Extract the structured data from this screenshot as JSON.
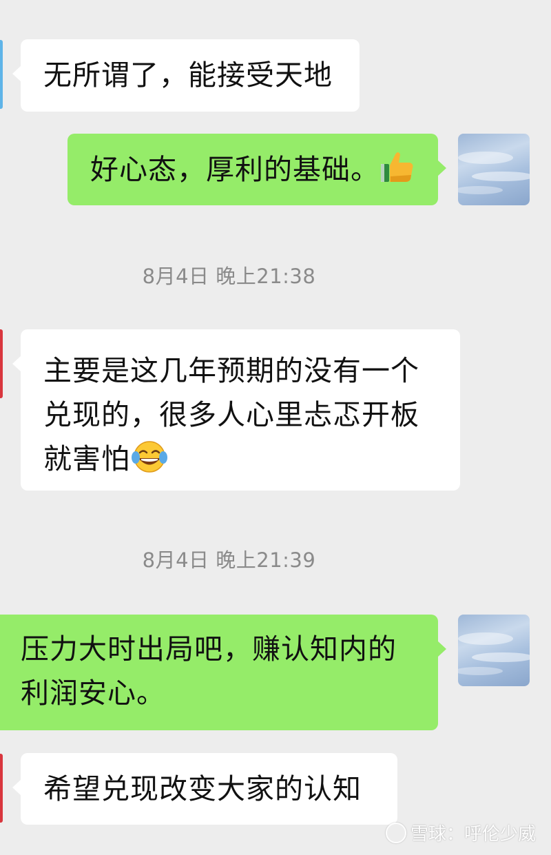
{
  "messages": [
    {
      "id": "m1",
      "text": "无所谓了，能接受天地"
    },
    {
      "id": "m2",
      "text": "好心态，厚利的基础。",
      "emoji": "thumbs-up-icon"
    },
    {
      "id": "m3",
      "text_line1": "主要是这几年预期的没有一个",
      "text_line2": "兑现的，很多人心里忐忑开板",
      "text_line3": "就害怕",
      "emoji": "tears-of-joy-icon"
    },
    {
      "id": "m4",
      "text_line1": "压力大时出局吧，赚认知内的",
      "text_line2": "利润安心。"
    },
    {
      "id": "m5",
      "text": "希望兑现改变大家的认知"
    }
  ],
  "timestamps": [
    "8月4日 晚上21:38",
    "8月4日 晚上21:39"
  ],
  "watermark": {
    "text": "雪球：呼伦少威"
  },
  "colors": {
    "background": "#ededed",
    "incoming_bubble": "#ffffff",
    "outgoing_bubble": "#95ec69",
    "timestamp_text": "#8a8a8a",
    "avatar_left_1": "#5fb4e8",
    "avatar_left_2": "#d9363e"
  }
}
